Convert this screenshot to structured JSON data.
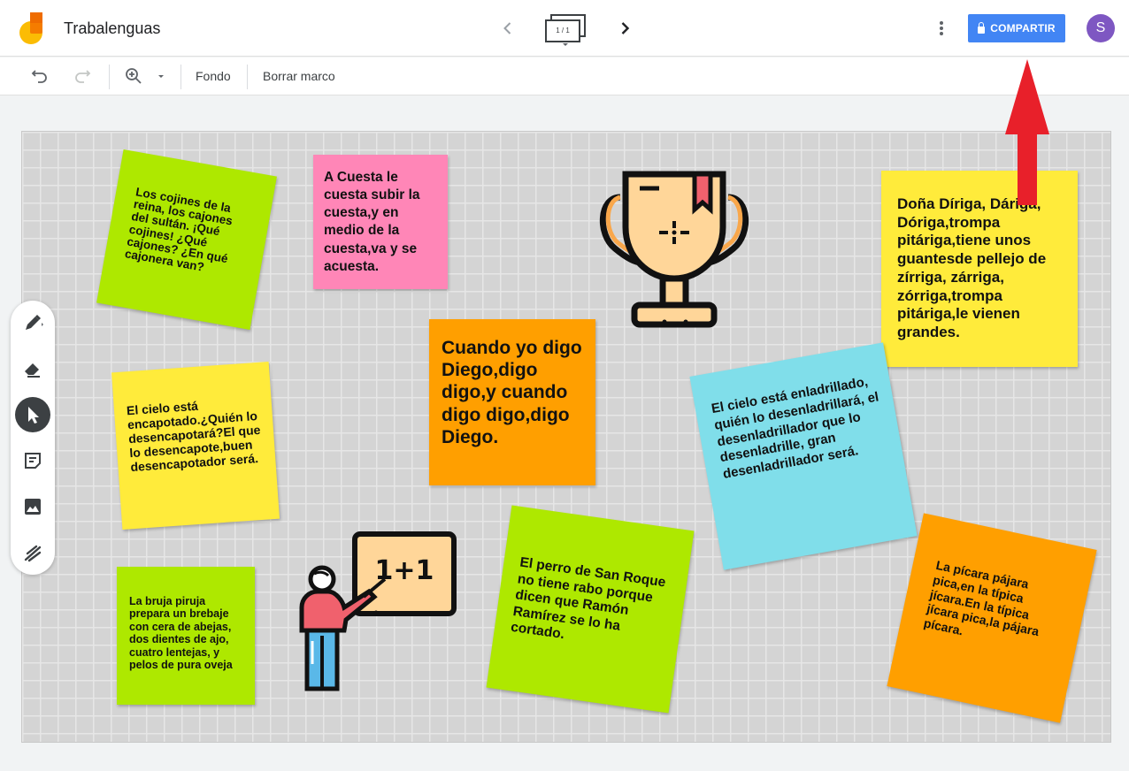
{
  "app": {
    "title": "Trabalenguas",
    "frame_indicator": "1 / 1",
    "share_label": "COMPARTIR",
    "avatar_letter": "S"
  },
  "toolbar": {
    "background_label": "Fondo",
    "clear_frame_label": "Borrar marco"
  },
  "side_tools": [
    {
      "name": "pen-icon"
    },
    {
      "name": "eraser-icon"
    },
    {
      "name": "select-icon",
      "active": true
    },
    {
      "name": "sticky-note-icon"
    },
    {
      "name": "image-icon"
    },
    {
      "name": "laser-icon"
    }
  ],
  "notes": [
    {
      "id": "cojines",
      "color": "#aee800",
      "text": "Los cojines de la reina, los cajones del sultán. ¡Qué cojines! ¿Qué cajones? ¿En qué cajonera van?"
    },
    {
      "id": "cuesta",
      "color": "#ff86b7",
      "text": "A Cuesta le cuesta subir la cuesta,y en medio de la cuesta,va y se acuesta."
    },
    {
      "id": "diego",
      "color": "#ff9f00",
      "text": "Cuando yo digo Diego,digo digo,y cuando digo digo,digo Diego."
    },
    {
      "id": "dirigia",
      "color": "#ffeb3b",
      "text": "Doña Díriga, Dáriga, Dóriga,trompa pitáriga,tiene unos guantesde pellejo de zírriga, zárriga, zórriga,trompa pitáriga,le vienen grandes."
    },
    {
      "id": "encapotado",
      "color": "#ffeb3b",
      "text": "El cielo está encapotado.¿Quién lo desencapotará?El que lo desencapote,buen desencapotador será."
    },
    {
      "id": "enladrillado",
      "color": "#80deea",
      "text": "El cielo está enladrillado, quién lo desenladrillará, el desenladrillador que lo desenladrille, gran desenladrillador será."
    },
    {
      "id": "bruja",
      "color": "#aee800",
      "text": "La bruja piruja prepara un brebaje con cera de abejas, dos dientes de ajo, cuatro lentejas, y pelos de pura oveja"
    },
    {
      "id": "perro",
      "color": "#aee800",
      "text": "El perro de San Roque no tiene rabo porque dicen que Ramón Ramírez se lo ha cortado."
    },
    {
      "id": "picara",
      "color": "#ff9f00",
      "text": "La pícara pájara pica,en la típica jícara.En la típica jícara pica,la pájara pícara."
    }
  ],
  "stickers": {
    "teacher_board_text": "1+1"
  },
  "colors": {
    "accent": "#4285f4",
    "avatar": "#7e57c2",
    "arrow": "#e8202a"
  }
}
